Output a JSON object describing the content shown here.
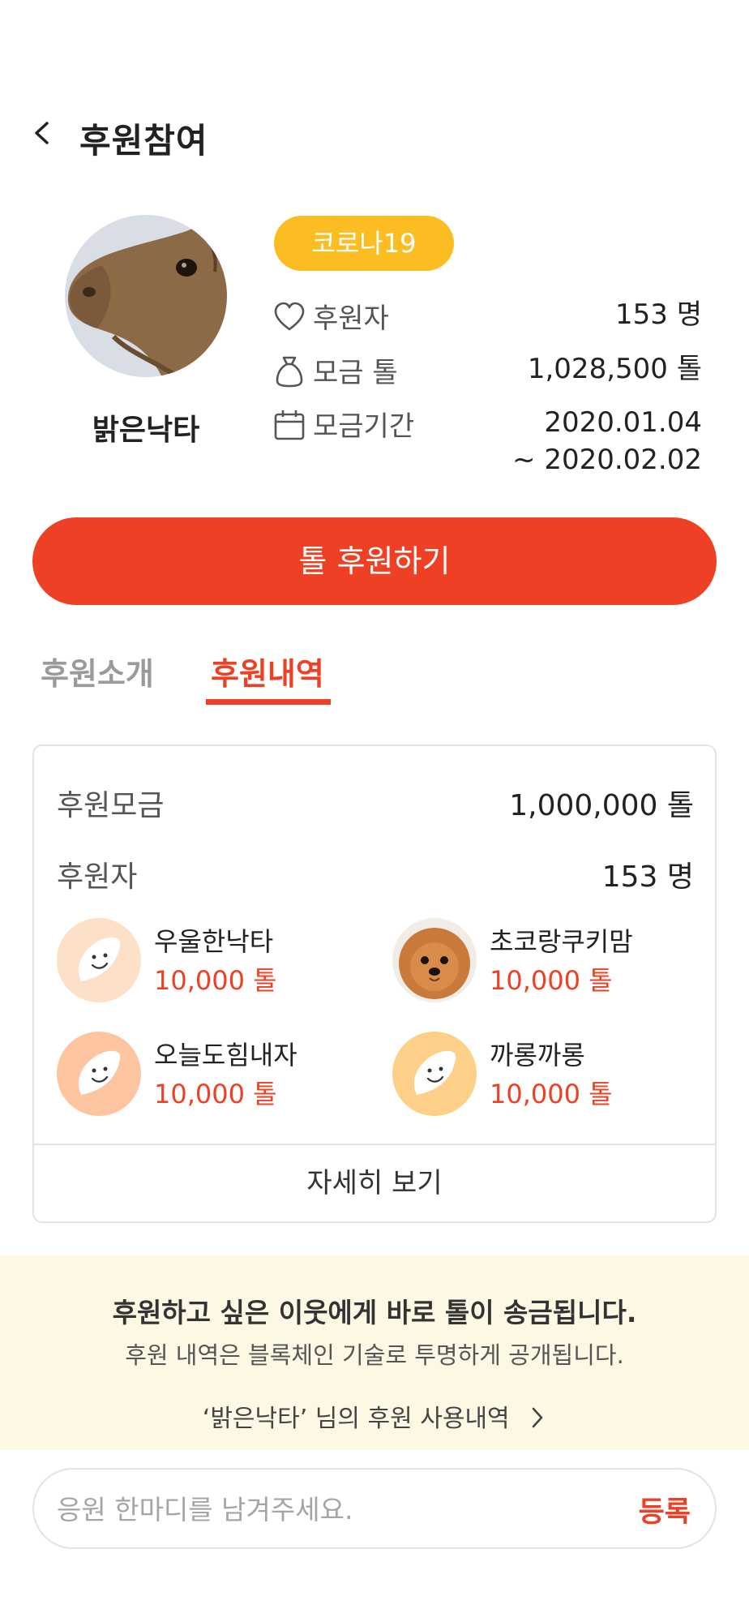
{
  "header": {
    "title": "후원참여"
  },
  "profile": {
    "name": "밝은낙타"
  },
  "campaign": {
    "tag": "코로나19",
    "stats": [
      {
        "icon": "heart-icon",
        "label": "후원자",
        "value": "153 명"
      },
      {
        "icon": "pouch-icon",
        "label": "모금 톨",
        "value": "1,028,500 톨"
      },
      {
        "icon": "calendar-icon",
        "label": "모금기간",
        "value": "2020.01.04",
        "value2": "~ 2020.02.02"
      }
    ]
  },
  "cta": {
    "label": "톨 후원하기"
  },
  "tabs": {
    "intro": "후원소개",
    "history": "후원내역"
  },
  "summary": {
    "fund_label": "후원모금",
    "fund_value": "1,000,000 톨",
    "donors_label": "후원자",
    "donors_value": "153 명"
  },
  "donors": [
    {
      "name": "우울한낙타",
      "amount": "10,000 톨",
      "avatar": "face-icon"
    },
    {
      "name": "초코랑쿠키맘",
      "amount": "10,000 톨",
      "avatar": "dog-photo"
    },
    {
      "name": "오늘도힘내자",
      "amount": "10,000 톨",
      "avatar": "face-icon"
    },
    {
      "name": "까롱까롱",
      "amount": "10,000 톨",
      "avatar": "face-icon"
    }
  ],
  "more": {
    "label": "자세히 보기"
  },
  "notice": {
    "line1": "후원하고 싶은 이웃에게 바로 톨이 송금됩니다.",
    "line2": "후원 내역은 블록체인 기술로 투명하게 공개됩니다.",
    "link": "‘밝은낙타’ 님의 후원 사용내역"
  },
  "comment": {
    "placeholder": "응원 한마디를 남겨주세요.",
    "submit": "등록"
  },
  "colors": {
    "accent": "#ee4024",
    "tag": "#fbbd22",
    "notice_bg": "#fdf8e4"
  }
}
